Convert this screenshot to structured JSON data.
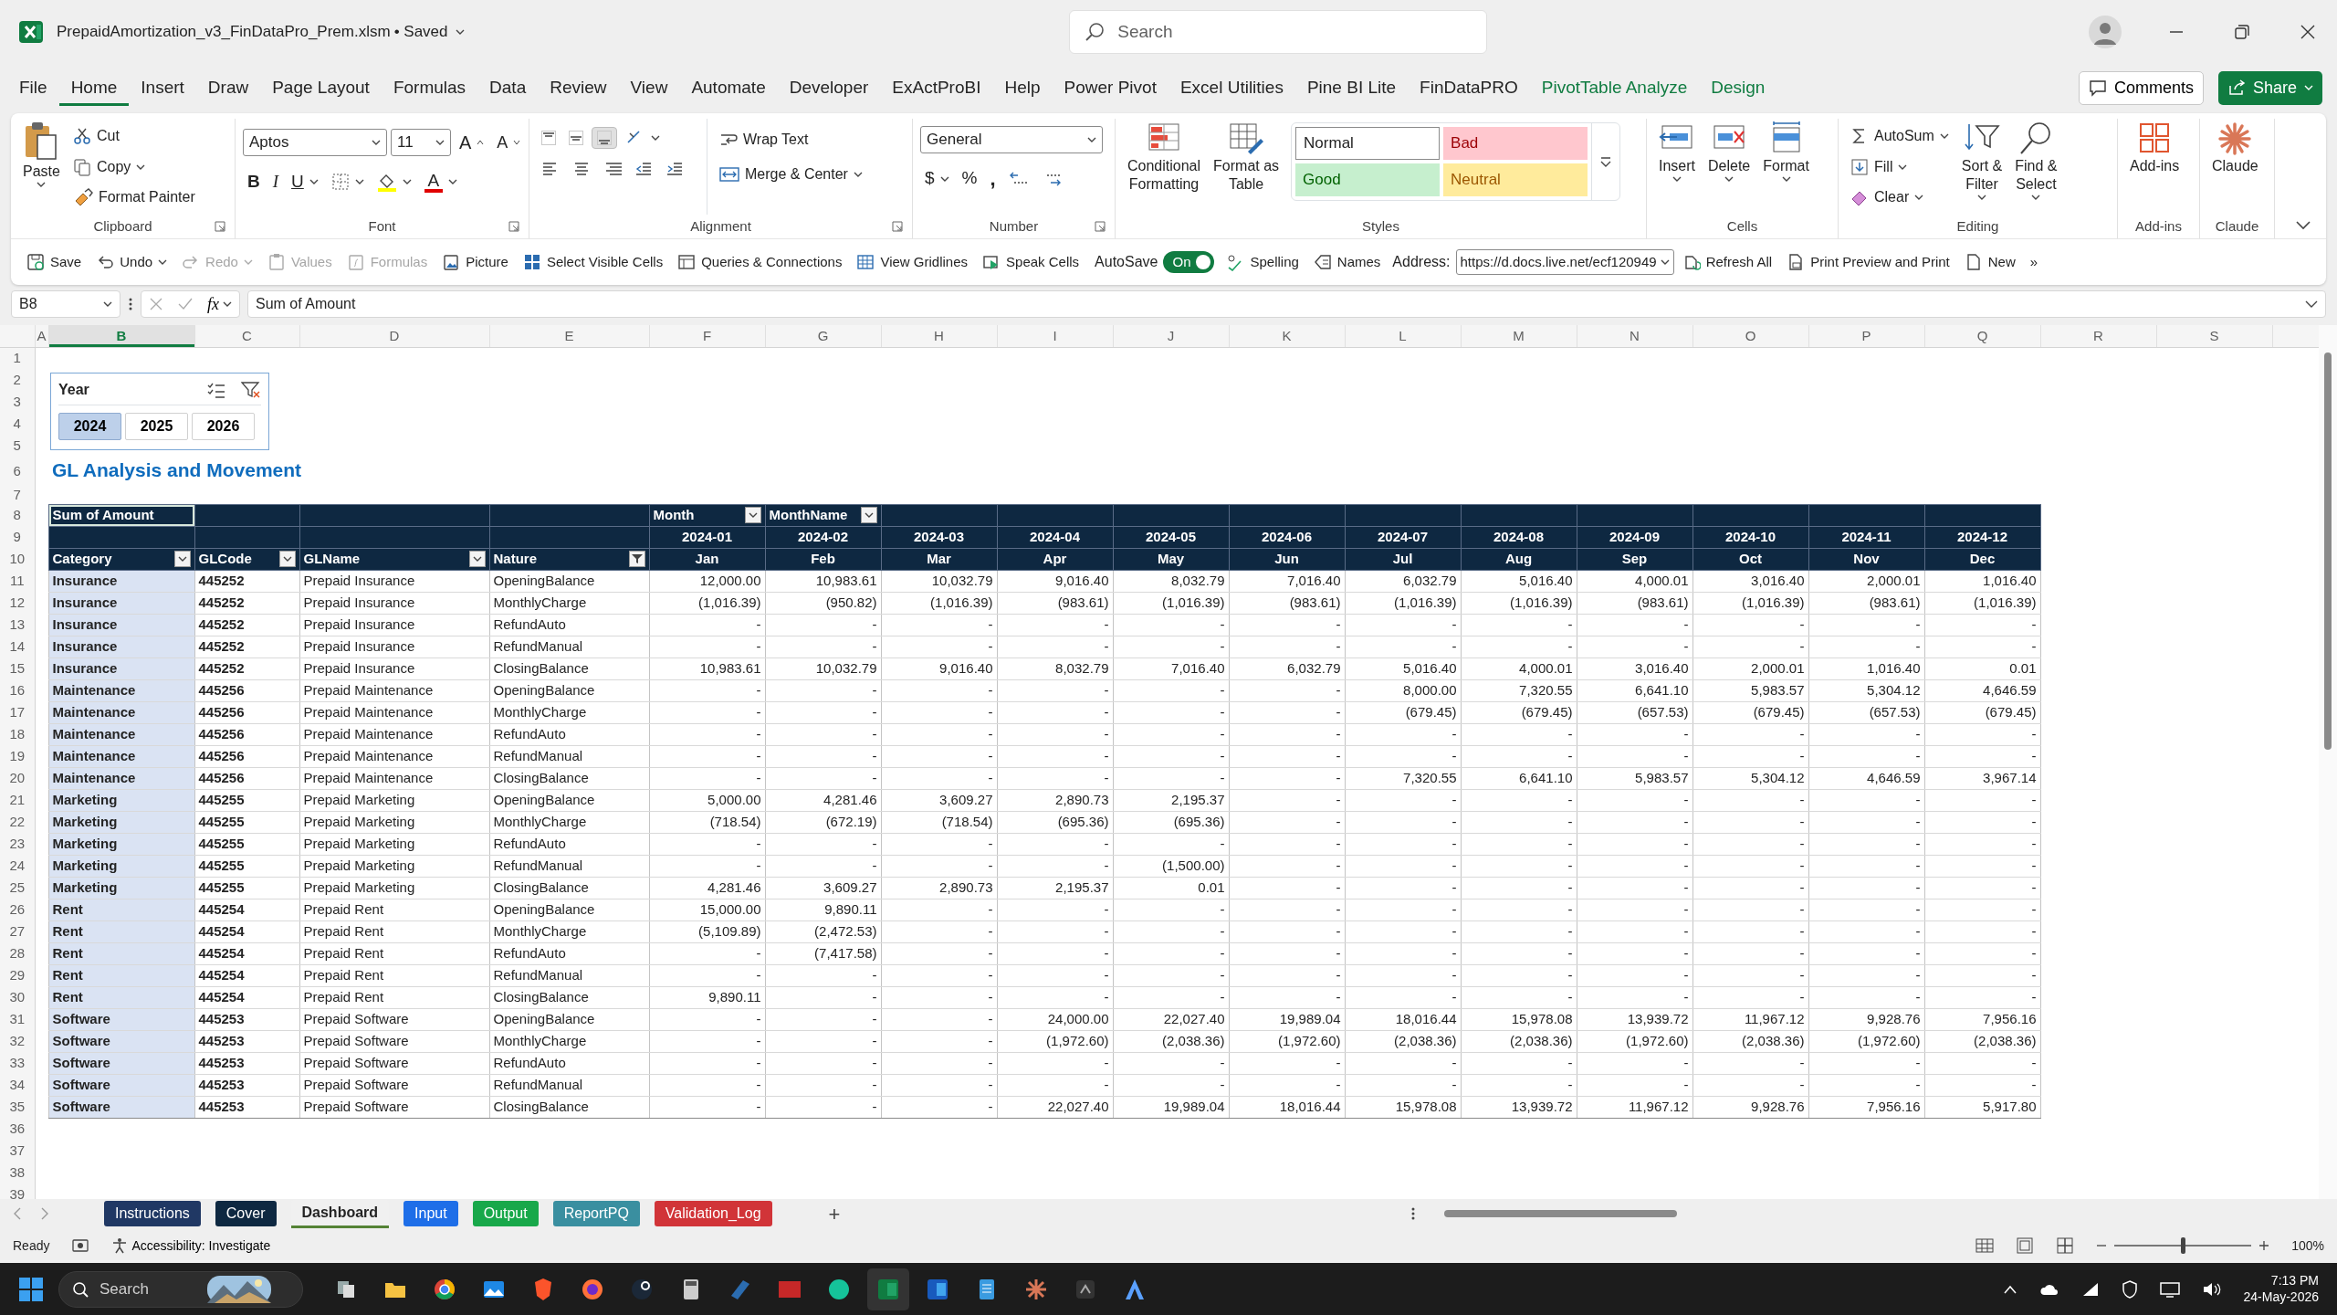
{
  "window": {
    "title": "PrepaidAmortization_v3_FinDataPro_Prem.xlsm",
    "save_status": "• Saved",
    "search_placeholder": "Search"
  },
  "menu_tabs": [
    {
      "label": "File",
      "selected": false,
      "kind": "normal"
    },
    {
      "label": "Home",
      "selected": true,
      "kind": "normal"
    },
    {
      "label": "Insert",
      "selected": false,
      "kind": "normal"
    },
    {
      "label": "Draw",
      "selected": false,
      "kind": "normal"
    },
    {
      "label": "Page Layout",
      "selected": false,
      "kind": "normal"
    },
    {
      "label": "Formulas",
      "selected": false,
      "kind": "normal"
    },
    {
      "label": "Data",
      "selected": false,
      "kind": "normal"
    },
    {
      "label": "Review",
      "selected": false,
      "kind": "normal"
    },
    {
      "label": "View",
      "selected": false,
      "kind": "normal"
    },
    {
      "label": "Automate",
      "selected": false,
      "kind": "normal"
    },
    {
      "label": "Developer",
      "selected": false,
      "kind": "normal"
    },
    {
      "label": "ExActProBI",
      "selected": false,
      "kind": "normal"
    },
    {
      "label": "Help",
      "selected": false,
      "kind": "normal"
    },
    {
      "label": "Power Pivot",
      "selected": false,
      "kind": "normal"
    },
    {
      "label": "Excel Utilities",
      "selected": false,
      "kind": "normal"
    },
    {
      "label": "Pine BI Lite",
      "selected": false,
      "kind": "normal"
    },
    {
      "label": "FinDataPRO",
      "selected": false,
      "kind": "normal"
    },
    {
      "label": "PivotTable Analyze",
      "selected": false,
      "kind": "contextual"
    },
    {
      "label": "Design",
      "selected": false,
      "kind": "contextual"
    }
  ],
  "header_buttons": {
    "comments": "Comments",
    "share": "Share"
  },
  "ribbon": {
    "clipboard": {
      "label": "Clipboard",
      "paste": "Paste",
      "cut": "Cut",
      "copy": "Copy",
      "format_painter": "Format Painter"
    },
    "font": {
      "label": "Font",
      "font_name": "Aptos",
      "font_size": "11",
      "grow": "A",
      "shrink": "A",
      "bold": "B",
      "italic": "I",
      "underline": "U",
      "font_color": "A"
    },
    "alignment": {
      "label": "Alignment",
      "vertical_align": [
        {
          "selected": false
        },
        {
          "selected": false
        },
        {
          "selected": true
        }
      ],
      "wrap_text": "Wrap Text",
      "merge_center": "Merge & Center"
    },
    "number": {
      "label": "Number",
      "format": "General",
      "currency": "$",
      "percent": "%",
      "comma": ","
    },
    "styles": {
      "label": "Styles",
      "conditional_formatting": [
        "Conditional",
        "Formatting"
      ],
      "format_as_table": [
        "Format as",
        "Table"
      ],
      "cell_styles": [
        {
          "label": "Normal",
          "kind": "normal"
        },
        {
          "label": "Bad",
          "kind": "bad"
        },
        {
          "label": "Good",
          "kind": "good"
        },
        {
          "label": "Neutral",
          "kind": "neutral"
        }
      ]
    },
    "cells": {
      "label": "Cells",
      "buttons": [
        "Insert",
        "Delete",
        "Format"
      ]
    },
    "editing": {
      "label": "Editing",
      "autosum": "AutoSum",
      "fill": "Fill",
      "clear": "Clear",
      "sort_filter": [
        "Sort &",
        "Filter"
      ],
      "find_select": [
        "Find &",
        "Select"
      ]
    },
    "addins": {
      "label": "Add-ins",
      "button": "Add-ins"
    },
    "claude": {
      "label": "Claude",
      "button": "Claude"
    }
  },
  "quick_access": {
    "left": [
      {
        "label": "Save",
        "disabled": false,
        "dropdown": false
      },
      {
        "label": "Undo",
        "disabled": false,
        "dropdown": true
      },
      {
        "label": "Redo",
        "disabled": true,
        "dropdown": true
      },
      {
        "label": "Values",
        "disabled": true,
        "dropdown": false
      },
      {
        "label": "Formulas",
        "disabled": true,
        "dropdown": false
      },
      {
        "label": "Picture",
        "disabled": false,
        "dropdown": false
      },
      {
        "label": "Select Visible Cells",
        "disabled": false,
        "dropdown": false
      },
      {
        "label": "Queries & Connections",
        "disabled": false,
        "dropdown": false
      },
      {
        "label": "View Gridlines",
        "disabled": false,
        "dropdown": false
      },
      {
        "label": "Speak Cells",
        "disabled": false,
        "dropdown": false
      }
    ],
    "autosave": {
      "label": "AutoSave",
      "state": "On",
      "on": true
    },
    "middle": [
      "Spelling",
      "Names"
    ],
    "address": {
      "label": "Address:",
      "value": "https://d.docs.live.net/ecf120949"
    },
    "right": [
      "Refresh All",
      "Print Preview and Print",
      "New"
    ],
    "overflow": "»"
  },
  "formula_bar": {
    "name_box": "B8",
    "fx": "fx",
    "formula": "Sum of Amount"
  },
  "grid": {
    "columns": [
      {
        "label": "A",
        "selected": false
      },
      {
        "label": "B",
        "selected": true
      },
      {
        "label": "C",
        "selected": false
      },
      {
        "label": "D",
        "selected": false
      },
      {
        "label": "E",
        "selected": false
      },
      {
        "label": "F",
        "selected": false
      },
      {
        "label": "G",
        "selected": false
      },
      {
        "label": "H",
        "selected": false
      },
      {
        "label": "I",
        "selected": false
      },
      {
        "label": "J",
        "selected": false
      },
      {
        "label": "K",
        "selected": false
      },
      {
        "label": "L",
        "selected": false
      },
      {
        "label": "M",
        "selected": false
      },
      {
        "label": "N",
        "selected": false
      },
      {
        "label": "O",
        "selected": false
      },
      {
        "label": "P",
        "selected": false
      },
      {
        "label": "Q",
        "selected": false
      },
      {
        "label": "R",
        "selected": false
      },
      {
        "label": "S",
        "selected": false
      }
    ],
    "row_numbers": [
      "1",
      "2",
      "3",
      "4",
      "5",
      "6",
      "7",
      "8",
      "9",
      "10",
      "11",
      "12",
      "13",
      "14",
      "15",
      "16",
      "17",
      "18",
      "19",
      "20",
      "21",
      "22",
      "23",
      "24",
      "25",
      "26",
      "27",
      "28",
      "29",
      "30",
      "31",
      "32",
      "33",
      "34",
      "35",
      "36",
      "37",
      "38",
      "39"
    ]
  },
  "slicer": {
    "title": "Year",
    "items": [
      {
        "label": "2024",
        "selected": true
      },
      {
        "label": "2025",
        "selected": false
      },
      {
        "label": "2026",
        "selected": false
      }
    ]
  },
  "sheet_title": "GL Analysis and Movement",
  "pivot": {
    "corner": "Sum of Amount",
    "column_fields": [
      "Month",
      "MonthName"
    ],
    "row_fields": [
      {
        "label": "Category",
        "filtered": false
      },
      {
        "label": "GLCode",
        "filtered": false
      },
      {
        "label": "GLName",
        "filtered": false
      },
      {
        "label": "Nature",
        "filtered": true
      }
    ],
    "periods": [
      "2024-01",
      "2024-02",
      "2024-03",
      "2024-04",
      "2024-05",
      "2024-06",
      "2024-07",
      "2024-08",
      "2024-09",
      "2024-10",
      "2024-11",
      "2024-12"
    ],
    "months": [
      "Jan",
      "Feb",
      "Mar",
      "Apr",
      "May",
      "Jun",
      "Jul",
      "Aug",
      "Sep",
      "Oct",
      "Nov",
      "Dec"
    ],
    "rows": [
      {
        "category": "Insurance",
        "glcode": "445252",
        "glname": "Prepaid Insurance",
        "nature": "OpeningBalance",
        "values": [
          "12,000.00",
          "10,983.61",
          "10,032.79",
          "9,016.40",
          "8,032.79",
          "7,016.40",
          "6,032.79",
          "5,016.40",
          "4,000.01",
          "3,016.40",
          "2,000.01",
          "1,016.40"
        ]
      },
      {
        "category": "Insurance",
        "glcode": "445252",
        "glname": "Prepaid Insurance",
        "nature": "MonthlyCharge",
        "values": [
          "(1,016.39)",
          "(950.82)",
          "(1,016.39)",
          "(983.61)",
          "(1,016.39)",
          "(983.61)",
          "(1,016.39)",
          "(1,016.39)",
          "(983.61)",
          "(1,016.39)",
          "(983.61)",
          "(1,016.39)"
        ]
      },
      {
        "category": "Insurance",
        "glcode": "445252",
        "glname": "Prepaid Insurance",
        "nature": "RefundAuto",
        "values": [
          "-",
          "-",
          "-",
          "-",
          "-",
          "-",
          "-",
          "-",
          "-",
          "-",
          "-",
          "-"
        ]
      },
      {
        "category": "Insurance",
        "glcode": "445252",
        "glname": "Prepaid Insurance",
        "nature": "RefundManual",
        "values": [
          "-",
          "-",
          "-",
          "-",
          "-",
          "-",
          "-",
          "-",
          "-",
          "-",
          "-",
          "-"
        ]
      },
      {
        "category": "Insurance",
        "glcode": "445252",
        "glname": "Prepaid Insurance",
        "nature": "ClosingBalance",
        "values": [
          "10,983.61",
          "10,032.79",
          "9,016.40",
          "8,032.79",
          "7,016.40",
          "6,032.79",
          "5,016.40",
          "4,000.01",
          "3,016.40",
          "2,000.01",
          "1,016.40",
          "0.01"
        ]
      },
      {
        "category": "Maintenance",
        "glcode": "445256",
        "glname": "Prepaid Maintenance",
        "nature": "OpeningBalance",
        "values": [
          "-",
          "-",
          "-",
          "-",
          "-",
          "-",
          "8,000.00",
          "7,320.55",
          "6,641.10",
          "5,983.57",
          "5,304.12",
          "4,646.59"
        ]
      },
      {
        "category": "Maintenance",
        "glcode": "445256",
        "glname": "Prepaid Maintenance",
        "nature": "MonthlyCharge",
        "values": [
          "-",
          "-",
          "-",
          "-",
          "-",
          "-",
          "(679.45)",
          "(679.45)",
          "(657.53)",
          "(679.45)",
          "(657.53)",
          "(679.45)"
        ]
      },
      {
        "category": "Maintenance",
        "glcode": "445256",
        "glname": "Prepaid Maintenance",
        "nature": "RefundAuto",
        "values": [
          "-",
          "-",
          "-",
          "-",
          "-",
          "-",
          "-",
          "-",
          "-",
          "-",
          "-",
          "-"
        ]
      },
      {
        "category": "Maintenance",
        "glcode": "445256",
        "glname": "Prepaid Maintenance",
        "nature": "RefundManual",
        "values": [
          "-",
          "-",
          "-",
          "-",
          "-",
          "-",
          "-",
          "-",
          "-",
          "-",
          "-",
          "-"
        ]
      },
      {
        "category": "Maintenance",
        "glcode": "445256",
        "glname": "Prepaid Maintenance",
        "nature": "ClosingBalance",
        "values": [
          "-",
          "-",
          "-",
          "-",
          "-",
          "-",
          "7,320.55",
          "6,641.10",
          "5,983.57",
          "5,304.12",
          "4,646.59",
          "3,967.14"
        ]
      },
      {
        "category": "Marketing",
        "glcode": "445255",
        "glname": "Prepaid Marketing",
        "nature": "OpeningBalance",
        "values": [
          "5,000.00",
          "4,281.46",
          "3,609.27",
          "2,890.73",
          "2,195.37",
          "-",
          "-",
          "-",
          "-",
          "-",
          "-",
          "-"
        ]
      },
      {
        "category": "Marketing",
        "glcode": "445255",
        "glname": "Prepaid Marketing",
        "nature": "MonthlyCharge",
        "values": [
          "(718.54)",
          "(672.19)",
          "(718.54)",
          "(695.36)",
          "(695.36)",
          "-",
          "-",
          "-",
          "-",
          "-",
          "-",
          "-"
        ]
      },
      {
        "category": "Marketing",
        "glcode": "445255",
        "glname": "Prepaid Marketing",
        "nature": "RefundAuto",
        "values": [
          "-",
          "-",
          "-",
          "-",
          "-",
          "-",
          "-",
          "-",
          "-",
          "-",
          "-",
          "-"
        ]
      },
      {
        "category": "Marketing",
        "glcode": "445255",
        "glname": "Prepaid Marketing",
        "nature": "RefundManual",
        "values": [
          "-",
          "-",
          "-",
          "-",
          "(1,500.00)",
          "-",
          "-",
          "-",
          "-",
          "-",
          "-",
          "-"
        ]
      },
      {
        "category": "Marketing",
        "glcode": "445255",
        "glname": "Prepaid Marketing",
        "nature": "ClosingBalance",
        "values": [
          "4,281.46",
          "3,609.27",
          "2,890.73",
          "2,195.37",
          "0.01",
          "-",
          "-",
          "-",
          "-",
          "-",
          "-",
          "-"
        ]
      },
      {
        "category": "Rent",
        "glcode": "445254",
        "glname": "Prepaid Rent",
        "nature": "OpeningBalance",
        "values": [
          "15,000.00",
          "9,890.11",
          "-",
          "-",
          "-",
          "-",
          "-",
          "-",
          "-",
          "-",
          "-",
          "-"
        ]
      },
      {
        "category": "Rent",
        "glcode": "445254",
        "glname": "Prepaid Rent",
        "nature": "MonthlyCharge",
        "values": [
          "(5,109.89)",
          "(2,472.53)",
          "-",
          "-",
          "-",
          "-",
          "-",
          "-",
          "-",
          "-",
          "-",
          "-"
        ]
      },
      {
        "category": "Rent",
        "glcode": "445254",
        "glname": "Prepaid Rent",
        "nature": "RefundAuto",
        "values": [
          "-",
          "(7,417.58)",
          "-",
          "-",
          "-",
          "-",
          "-",
          "-",
          "-",
          "-",
          "-",
          "-"
        ]
      },
      {
        "category": "Rent",
        "glcode": "445254",
        "glname": "Prepaid Rent",
        "nature": "RefundManual",
        "values": [
          "-",
          "-",
          "-",
          "-",
          "-",
          "-",
          "-",
          "-",
          "-",
          "-",
          "-",
          "-"
        ]
      },
      {
        "category": "Rent",
        "glcode": "445254",
        "glname": "Prepaid Rent",
        "nature": "ClosingBalance",
        "values": [
          "9,890.11",
          "-",
          "-",
          "-",
          "-",
          "-",
          "-",
          "-",
          "-",
          "-",
          "-",
          "-"
        ]
      },
      {
        "category": "Software",
        "glcode": "445253",
        "glname": "Prepaid Software",
        "nature": "OpeningBalance",
        "values": [
          "-",
          "-",
          "-",
          "24,000.00",
          "22,027.40",
          "19,989.04",
          "18,016.44",
          "15,978.08",
          "13,939.72",
          "11,967.12",
          "9,928.76",
          "7,956.16"
        ]
      },
      {
        "category": "Software",
        "glcode": "445253",
        "glname": "Prepaid Software",
        "nature": "MonthlyCharge",
        "values": [
          "-",
          "-",
          "-",
          "(1,972.60)",
          "(2,038.36)",
          "(1,972.60)",
          "(2,038.36)",
          "(2,038.36)",
          "(1,972.60)",
          "(2,038.36)",
          "(1,972.60)",
          "(2,038.36)"
        ]
      },
      {
        "category": "Software",
        "glcode": "445253",
        "glname": "Prepaid Software",
        "nature": "RefundAuto",
        "values": [
          "-",
          "-",
          "-",
          "-",
          "-",
          "-",
          "-",
          "-",
          "-",
          "-",
          "-",
          "-"
        ]
      },
      {
        "category": "Software",
        "glcode": "445253",
        "glname": "Prepaid Software",
        "nature": "RefundManual",
        "values": [
          "-",
          "-",
          "-",
          "-",
          "-",
          "-",
          "-",
          "-",
          "-",
          "-",
          "-",
          "-"
        ]
      },
      {
        "category": "Software",
        "glcode": "445253",
        "glname": "Prepaid Software",
        "nature": "ClosingBalance",
        "values": [
          "-",
          "-",
          "-",
          "22,027.40",
          "19,989.04",
          "18,016.44",
          "15,978.08",
          "13,939.72",
          "11,967.12",
          "9,928.76",
          "7,956.16",
          "5,917.80"
        ]
      }
    ]
  },
  "sheet_tabs": [
    {
      "label": "Instructions",
      "color": "#203864",
      "selected": false
    },
    {
      "label": "Cover",
      "color": "#0e2841",
      "selected": false
    },
    {
      "label": "Dashboard",
      "color": "#548235",
      "selected": true
    },
    {
      "label": "Input",
      "color": "#1e6ee8",
      "selected": false
    },
    {
      "label": "Output",
      "color": "#18a84a",
      "selected": false
    },
    {
      "label": "ReportPQ",
      "color": "#3a8fa0",
      "selected": false
    },
    {
      "label": "Validation_Log",
      "color": "#d13438",
      "selected": false
    }
  ],
  "add_sheet": "+",
  "status_bar": {
    "status": "Ready",
    "accessibility": "Accessibility: Investigate",
    "zoom_slider": {
      "level": 0.5
    },
    "zoom": "100%"
  },
  "taskbar": {
    "search_placeholder": "Search",
    "time": "7:13 PM",
    "date": "24-May-2026"
  }
}
